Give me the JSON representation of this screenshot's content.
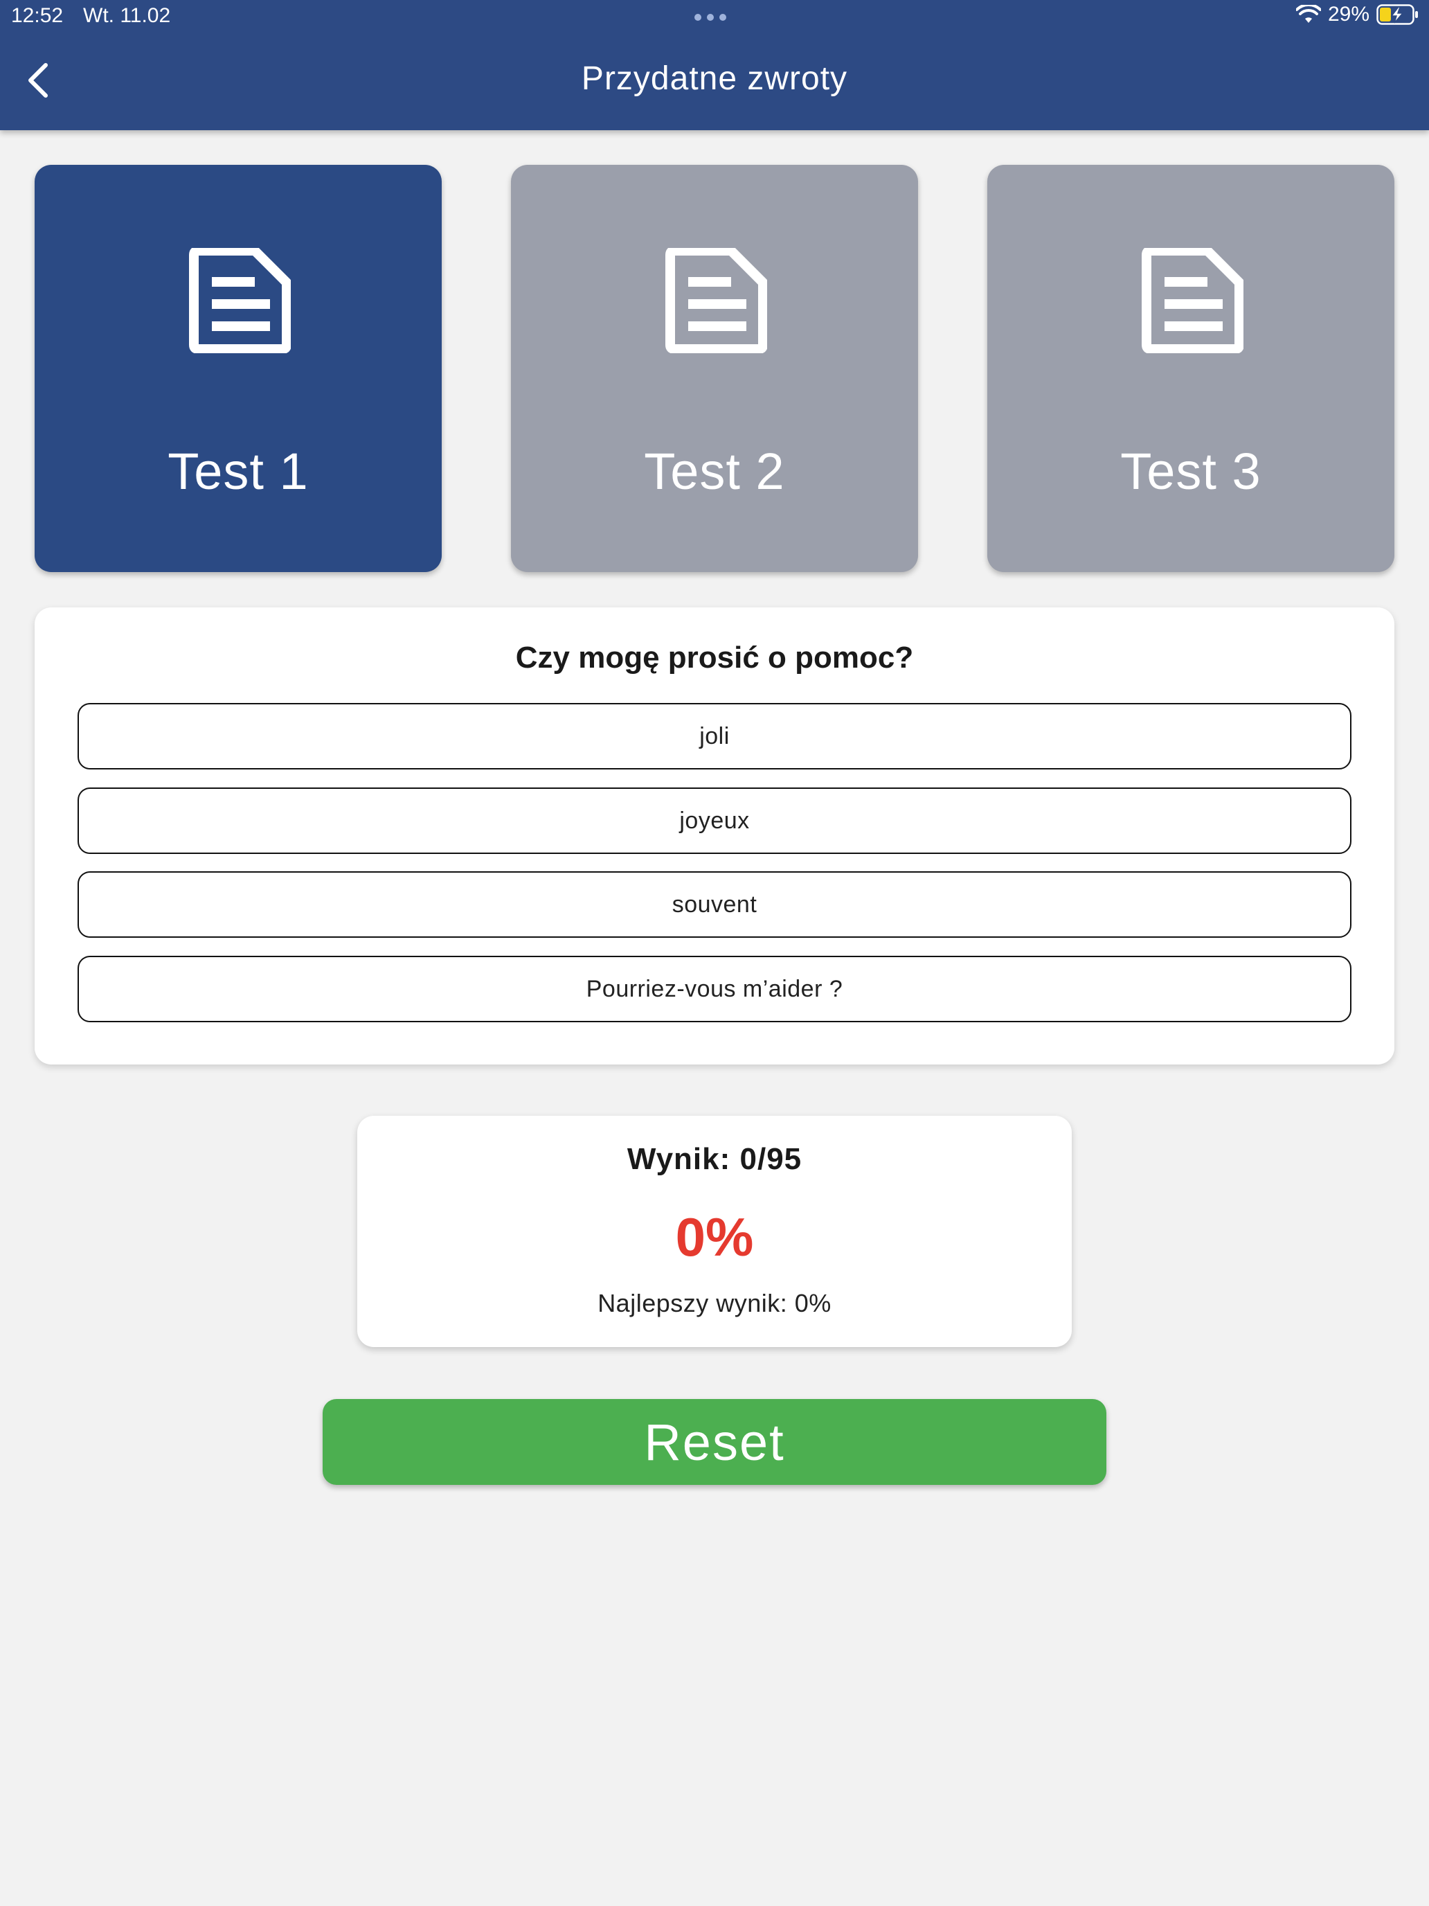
{
  "status_bar": {
    "time": "12:52",
    "date": "Wt. 11.02",
    "battery": "29%"
  },
  "header": {
    "title": "Przydatne zwroty",
    "back_icon": "chevron-left-icon"
  },
  "tests": [
    {
      "label": "Test 1",
      "active": true,
      "icon": "document-icon"
    },
    {
      "label": "Test 2",
      "active": false,
      "icon": "document-icon"
    },
    {
      "label": "Test 3",
      "active": false,
      "icon": "document-icon"
    }
  ],
  "question": {
    "text": "Czy mogę prosić o pomoc?",
    "answers": [
      "joli",
      "joyeux",
      "souvent",
      "Pourriez-vous m’aider ?"
    ]
  },
  "score": {
    "label": "Wynik: 0/95",
    "percent": "0%",
    "best": "Najlepszy wynik: 0%"
  },
  "reset_label": "Reset",
  "colors": {
    "header": "#2d4a84",
    "active_tile": "#2b4a84",
    "inactive_tile": "#9b9fab",
    "percent": "#e53a2f",
    "reset": "#4caf50"
  }
}
